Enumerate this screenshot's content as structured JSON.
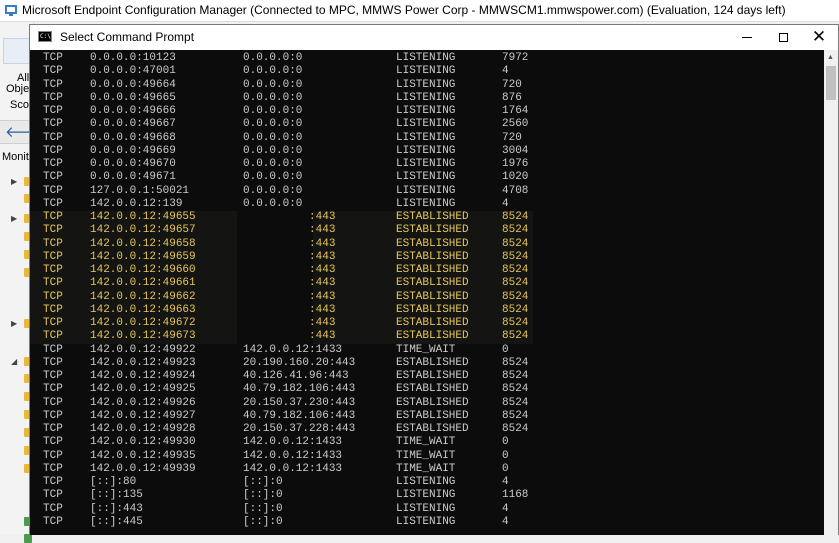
{
  "background_app": {
    "title": "Microsoft Endpoint Configuration Manager (Connected to MPC, MMWS Power Corp - MMWSCM1.mmwspower.com) (Evaluation, 124 days left)",
    "ribbon_label_1": "All",
    "ribbon_label_2": "Obje",
    "scope_label": "Scop",
    "workspace_label": "Monit"
  },
  "cmd_window": {
    "title": "Select Command Prompt",
    "rows": [
      {
        "proto": "TCP",
        "local": "0.0.0.0:10123",
        "foreign": "0.0.0.0:0",
        "state": "LISTENING",
        "pid": "7972",
        "hl": false
      },
      {
        "proto": "TCP",
        "local": "0.0.0.0:47001",
        "foreign": "0.0.0.0:0",
        "state": "LISTENING",
        "pid": "4",
        "hl": false
      },
      {
        "proto": "TCP",
        "local": "0.0.0.0:49664",
        "foreign": "0.0.0.0:0",
        "state": "LISTENING",
        "pid": "720",
        "hl": false
      },
      {
        "proto": "TCP",
        "local": "0.0.0.0:49665",
        "foreign": "0.0.0.0:0",
        "state": "LISTENING",
        "pid": "876",
        "hl": false
      },
      {
        "proto": "TCP",
        "local": "0.0.0.0:49666",
        "foreign": "0.0.0.0:0",
        "state": "LISTENING",
        "pid": "1764",
        "hl": false
      },
      {
        "proto": "TCP",
        "local": "0.0.0.0:49667",
        "foreign": "0.0.0.0:0",
        "state": "LISTENING",
        "pid": "2560",
        "hl": false
      },
      {
        "proto": "TCP",
        "local": "0.0.0.0:49668",
        "foreign": "0.0.0.0:0",
        "state": "LISTENING",
        "pid": "720",
        "hl": false
      },
      {
        "proto": "TCP",
        "local": "0.0.0.0:49669",
        "foreign": "0.0.0.0:0",
        "state": "LISTENING",
        "pid": "3004",
        "hl": false
      },
      {
        "proto": "TCP",
        "local": "0.0.0.0:49670",
        "foreign": "0.0.0.0:0",
        "state": "LISTENING",
        "pid": "1976",
        "hl": false
      },
      {
        "proto": "TCP",
        "local": "0.0.0.0:49671",
        "foreign": "0.0.0.0:0",
        "state": "LISTENING",
        "pid": "1020",
        "hl": false
      },
      {
        "proto": "TCP",
        "local": "127.0.0.1:50021",
        "foreign": "0.0.0.0:0",
        "state": "LISTENING",
        "pid": "4708",
        "hl": false
      },
      {
        "proto": "TCP",
        "local": "142.0.0.12:139",
        "foreign": "0.0.0.0:0",
        "state": "LISTENING",
        "pid": "4",
        "hl": false
      },
      {
        "proto": "TCP",
        "local": "142.0.0.12:49655",
        "foreign": "          :443",
        "state": "ESTABLISHED",
        "pid": "8524",
        "hl": true
      },
      {
        "proto": "TCP",
        "local": "142.0.0.12:49657",
        "foreign": "          :443",
        "state": "ESTABLISHED",
        "pid": "8524",
        "hl": true
      },
      {
        "proto": "TCP",
        "local": "142.0.0.12:49658",
        "foreign": "          :443",
        "state": "ESTABLISHED",
        "pid": "8524",
        "hl": true
      },
      {
        "proto": "TCP",
        "local": "142.0.0.12:49659",
        "foreign": "          :443",
        "state": "ESTABLISHED",
        "pid": "8524",
        "hl": true
      },
      {
        "proto": "TCP",
        "local": "142.0.0.12:49660",
        "foreign": "          :443",
        "state": "ESTABLISHED",
        "pid": "8524",
        "hl": true
      },
      {
        "proto": "TCP",
        "local": "142.0.0.12:49661",
        "foreign": "          :443",
        "state": "ESTABLISHED",
        "pid": "8524",
        "hl": true
      },
      {
        "proto": "TCP",
        "local": "142.0.0.12:49662",
        "foreign": "          :443",
        "state": "ESTABLISHED",
        "pid": "8524",
        "hl": true
      },
      {
        "proto": "TCP",
        "local": "142.0.0.12:49663",
        "foreign": "          :443",
        "state": "ESTABLISHED",
        "pid": "8524",
        "hl": true
      },
      {
        "proto": "TCP",
        "local": "142.0.0.12:49672",
        "foreign": "          :443",
        "state": "ESTABLISHED",
        "pid": "8524",
        "hl": true
      },
      {
        "proto": "TCP",
        "local": "142.0.0.12:49673",
        "foreign": "          :443",
        "state": "ESTABLISHED",
        "pid": "8524",
        "hl": true
      },
      {
        "proto": "TCP",
        "local": "142.0.0.12:49922",
        "foreign": "142.0.0.12:1433",
        "state": "TIME_WAIT",
        "pid": "0",
        "hl": false
      },
      {
        "proto": "TCP",
        "local": "142.0.0.12:49923",
        "foreign": "20.190.160.20:443",
        "state": "ESTABLISHED",
        "pid": "8524",
        "hl": false
      },
      {
        "proto": "TCP",
        "local": "142.0.0.12:49924",
        "foreign": "40.126.41.96:443",
        "state": "ESTABLISHED",
        "pid": "8524",
        "hl": false
      },
      {
        "proto": "TCP",
        "local": "142.0.0.12:49925",
        "foreign": "40.79.182.106:443",
        "state": "ESTABLISHED",
        "pid": "8524",
        "hl": false
      },
      {
        "proto": "TCP",
        "local": "142.0.0.12:49926",
        "foreign": "20.150.37.230:443",
        "state": "ESTABLISHED",
        "pid": "8524",
        "hl": false
      },
      {
        "proto": "TCP",
        "local": "142.0.0.12:49927",
        "foreign": "40.79.182.106:443",
        "state": "ESTABLISHED",
        "pid": "8524",
        "hl": false
      },
      {
        "proto": "TCP",
        "local": "142.0.0.12:49928",
        "foreign": "20.150.37.228:443",
        "state": "ESTABLISHED",
        "pid": "8524",
        "hl": false
      },
      {
        "proto": "TCP",
        "local": "142.0.0.12:49930",
        "foreign": "142.0.0.12:1433",
        "state": "TIME_WAIT",
        "pid": "0",
        "hl": false
      },
      {
        "proto": "TCP",
        "local": "142.0.0.12:49935",
        "foreign": "142.0.0.12:1433",
        "state": "TIME_WAIT",
        "pid": "0",
        "hl": false
      },
      {
        "proto": "TCP",
        "local": "142.0.0.12:49939",
        "foreign": "142.0.0.12:1433",
        "state": "TIME_WAIT",
        "pid": "0",
        "hl": false
      },
      {
        "proto": "TCP",
        "local": "[::]:80",
        "foreign": "[::]:0",
        "state": "LISTENING",
        "pid": "4",
        "hl": false
      },
      {
        "proto": "TCP",
        "local": "[::]:135",
        "foreign": "[::]:0",
        "state": "LISTENING",
        "pid": "1168",
        "hl": false
      },
      {
        "proto": "TCP",
        "local": "[::]:443",
        "foreign": "[::]:0",
        "state": "LISTENING",
        "pid": "4",
        "hl": false
      },
      {
        "proto": "TCP",
        "local": "[::]:445",
        "foreign": "[::]:0",
        "state": "LISTENING",
        "pid": "4",
        "hl": false
      }
    ]
  },
  "colors": {
    "console_bg": "#0c0c0c",
    "console_text": "#cccccc",
    "highlight_text": "#e5c75a"
  }
}
